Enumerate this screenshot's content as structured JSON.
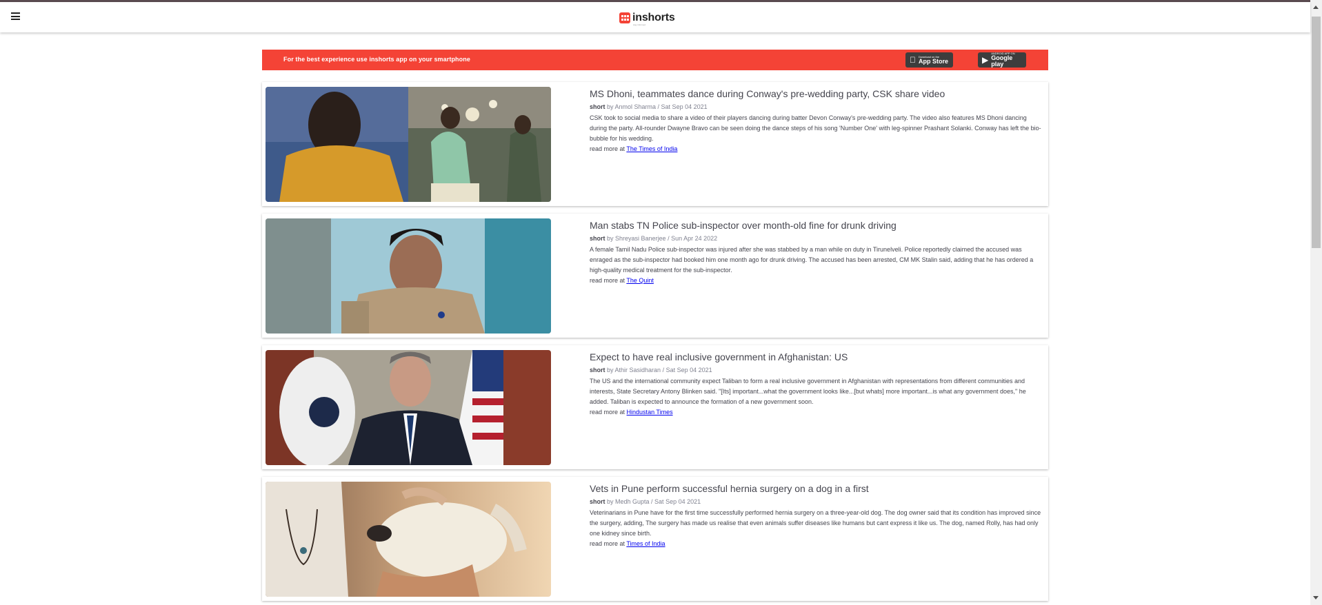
{
  "app": {
    "brand_name": "inshorts",
    "brand_tagline": "stay informed",
    "accent_color": "#f44336"
  },
  "promo": {
    "text": "For the best experience use inshorts app on your smartphone",
    "appstore_small": "Download on the",
    "appstore_big": "App Store",
    "playstore_small": "ANDROID APP ON",
    "playstore_big": "Google play"
  },
  "articles": [
    {
      "title": "MS Dhoni, teammates dance during Conway's pre-wedding party, CSK share video",
      "tag": "short",
      "byline": "by Anmol Sharma / Sat Sep 04 2021",
      "body": "CSK took to social media to share a video of their players dancing during batter Devon Conway's pre-wedding party. The video also features MS Dhoni dancing during the party. All-rounder Dwayne Bravo can be seen doing the dance steps of his song 'Number One' with leg-spinner Prashant Solanki. Conway has left the bio-bubble for his wedding.",
      "read_more_prefix": "read more at",
      "source": "The Times of India"
    },
    {
      "title": "Man stabs TN Police sub-inspector over month-old fine for drunk driving",
      "tag": "short",
      "byline": "by Shreyasi Banerjee / Sun Apr 24 2022",
      "body": "A female Tamil Nadu Police sub-inspector was injured after she was stabbed by a man while on duty in Tirunelveli. Police reportedly claimed the accused was enraged as the sub-inspector had booked him one month ago for drunk driving. The accused has been arrested, CM MK Stalin said, adding that he has ordered a high-quality medical treatment for the sub-inspector.",
      "read_more_prefix": "read more at",
      "source": "The Quint"
    },
    {
      "title": "Expect to have real inclusive government in Afghanistan: US",
      "tag": "short",
      "byline": "by Athir Sasidharan / Sat Sep 04 2021",
      "body": "The US and the international community expect Taliban to form a real inclusive government in Afghanistan with representations from different communities and interests, State Secretary Antony Blinken said. \"[Its] important...what the government looks like...[but whats] more important...is what any government does,\" he added. Taliban is expected to announce the formation of a new government soon.",
      "read_more_prefix": "read more at",
      "source": "Hindustan Times"
    },
    {
      "title": "Vets in Pune perform successful hernia surgery on a dog in a first",
      "tag": "short",
      "byline": "by Medh Gupta / Sat Sep 04 2021",
      "body": "Veterinarians in Pune have for the first time successfully performed hernia surgery on a three-year-old dog. The dog owner said that its condition has improved since the surgery, adding, The surgery has made us realise that even animals suffer diseases like humans but cant express it like us. The dog, named Rolly, has had only one kidney since birth.",
      "read_more_prefix": "read more at",
      "source": "Times of India"
    }
  ]
}
